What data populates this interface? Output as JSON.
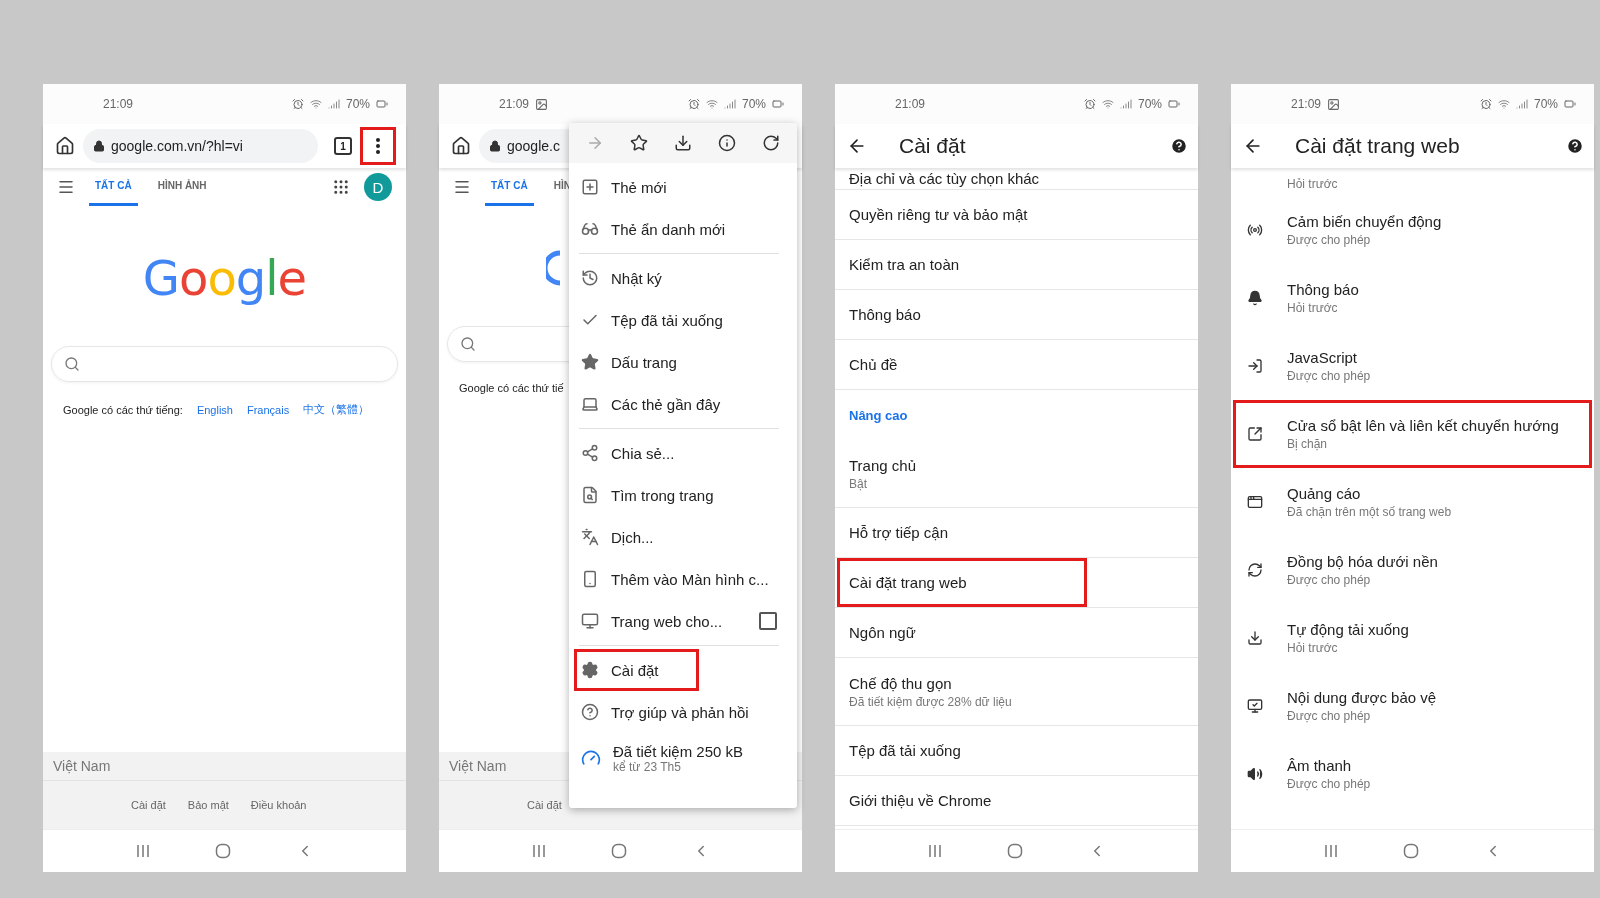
{
  "phones": [
    {
      "kind": "browser",
      "status_bar": {
        "time": "21:09",
        "battery": "70%",
        "gallery_notice": false
      },
      "address_bar": {
        "url": "google.com.vn/?hl=vi",
        "tab_count": "1",
        "menu_highlighted": true
      },
      "search_tabs": [
        {
          "label": "TẤT CẢ",
          "selected": true
        },
        {
          "label": "HÌNH ẢNH",
          "selected": false
        }
      ],
      "avatar": "D",
      "logo": "Google",
      "languages": {
        "prompt": "Google có các thứ tiếng:",
        "links": [
          "English",
          "Français",
          "中文（繁體）"
        ]
      },
      "footer": {
        "country": "Việt Nam",
        "links": [
          "Cài đặt",
          "Bảo mật",
          "Điều khoản"
        ]
      }
    },
    {
      "kind": "browser",
      "status_bar": {
        "time": "21:09",
        "battery": "70%",
        "gallery_notice": true
      },
      "address_bar": {
        "url": "google.c"
      },
      "search_tabs": [
        {
          "label": "TẤT CẢ",
          "selected": true
        },
        {
          "label": "HÌN",
          "selected": false
        }
      ],
      "languages": {
        "prompt": "Google có các thứ tiế"
      },
      "footer": {
        "country": "Việt Nam",
        "links": [
          "Cài đặt"
        ]
      },
      "menu": {
        "sections": [
          [
            {
              "kind": "item",
              "label": "Thẻ mới",
              "highlighted": false
            },
            {
              "kind": "item",
              "label": "Thẻ ẩn danh mới",
              "highlighted": false
            }
          ],
          [
            {
              "kind": "item",
              "label": "Nhật ký",
              "highlighted": false
            },
            {
              "kind": "item",
              "label": "Tệp đã tải xuống",
              "highlighted": false
            },
            {
              "kind": "item",
              "label": "Dấu trang",
              "highlighted": false
            },
            {
              "kind": "item",
              "label": "Các thẻ gần đây",
              "highlighted": false
            }
          ],
          [
            {
              "kind": "item",
              "label": "Chia sẻ...",
              "highlighted": false
            },
            {
              "kind": "item",
              "label": "Tìm trong trang",
              "highlighted": false
            },
            {
              "kind": "item",
              "label": "Dịch...",
              "highlighted": false
            },
            {
              "kind": "item",
              "label": "Thêm vào Màn hình c...",
              "highlighted": false
            },
            {
              "kind": "checkbox",
              "label": "Trang web cho...",
              "checked": false,
              "highlighted": false
            }
          ],
          [
            {
              "kind": "item",
              "label": "Cài đặt",
              "highlighted": true
            },
            {
              "kind": "item",
              "label": "Trợ giúp và phản hồi",
              "highlighted": false
            },
            {
              "kind": "savings",
              "label": "Đã tiết kiệm 250 kB",
              "sublabel": "kể từ 23 Th5",
              "highlighted": false
            }
          ]
        ]
      }
    },
    {
      "kind": "settings",
      "status_bar": {
        "time": "21:09",
        "battery": "70%",
        "gallery_notice": false
      },
      "title": "Cài đặt",
      "items": [
        {
          "kind": "partial",
          "label": "Địa chỉ và các tùy chọn khác",
          "highlighted": false
        },
        {
          "kind": "item",
          "label": "Quyền riêng tư và bảo mật",
          "highlighted": false
        },
        {
          "kind": "item",
          "label": "Kiểm tra an toàn",
          "highlighted": false
        },
        {
          "kind": "item",
          "label": "Thông báo",
          "highlighted": false
        },
        {
          "kind": "item",
          "label": "Chủ đề",
          "highlighted": false
        },
        {
          "kind": "section",
          "label": "Nâng cao",
          "highlighted": false
        },
        {
          "kind": "item",
          "label": "Trang chủ",
          "sublabel": "Bật",
          "highlighted": false
        },
        {
          "kind": "item",
          "label": "Hỗ trợ tiếp cận",
          "highlighted": false
        },
        {
          "kind": "item",
          "label": "Cài đặt trang web",
          "highlighted": true
        },
        {
          "kind": "item",
          "label": "Ngôn ngữ",
          "highlighted": false
        },
        {
          "kind": "item",
          "label": "Chế độ thu gọn",
          "sublabel": "Đã tiết kiệm được 28% dữ liệu",
          "highlighted": false
        },
        {
          "kind": "item",
          "label": "Tệp đã tải xuống",
          "highlighted": false
        },
        {
          "kind": "item",
          "label": "Giới thiệu về Chrome",
          "highlighted": false
        }
      ]
    },
    {
      "kind": "site_settings",
      "status_bar": {
        "time": "21:09",
        "battery": "70%",
        "gallery_notice": true
      },
      "title": "Cài đặt trang web",
      "items": [
        {
          "kind": "partial",
          "sublabel": "Hỏi trước",
          "highlighted": false
        },
        {
          "kind": "item",
          "label": "Cảm biến chuyển động",
          "sublabel": "Được cho phép",
          "highlighted": false
        },
        {
          "kind": "item",
          "label": "Thông báo",
          "sublabel": "Hỏi trước",
          "highlighted": false
        },
        {
          "kind": "item",
          "label": "JavaScript",
          "sublabel": "Được cho phép",
          "highlighted": false
        },
        {
          "kind": "item",
          "label": "Cửa sổ bật lên và liên kết chuyển hướng",
          "sublabel": "Bị chặn",
          "highlighted": true
        },
        {
          "kind": "item",
          "label": "Quảng cáo",
          "sublabel": "Đã chặn trên một số trang web",
          "highlighted": false
        },
        {
          "kind": "item",
          "label": "Đồng bộ hóa dưới nền",
          "sublabel": "Được cho phép",
          "highlighted": false
        },
        {
          "kind": "item",
          "label": "Tự động tải xuống",
          "sublabel": "Hỏi trước",
          "highlighted": false
        },
        {
          "kind": "item",
          "label": "Nội dung được bảo vệ",
          "sublabel": "Được cho phép",
          "highlighted": false
        },
        {
          "kind": "item",
          "label": "Âm thanh",
          "sublabel": "Được cho phép",
          "highlighted": false
        }
      ]
    }
  ]
}
